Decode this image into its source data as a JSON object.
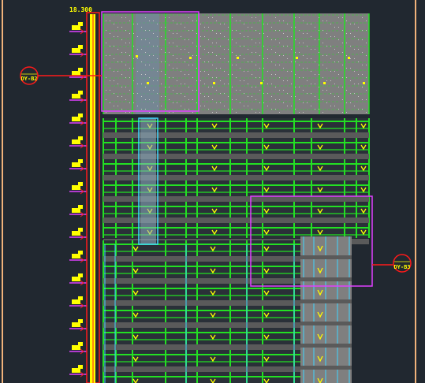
{
  "drawing": {
    "top_level_label": "18.300",
    "callouts": [
      {
        "id": "left",
        "label": "DY-B2"
      },
      {
        "id": "right",
        "label": "DY-B3"
      }
    ]
  },
  "colors": {
    "background": "#212830",
    "border": "#f0b27a",
    "yellow": "#ffff00",
    "magenta": "#e040ff",
    "green": "#23e023",
    "red": "#ff1a1a",
    "cyan": "#3fd6ff",
    "grey": "#7f7f7f",
    "dark_grey": "#5a5a5a"
  }
}
